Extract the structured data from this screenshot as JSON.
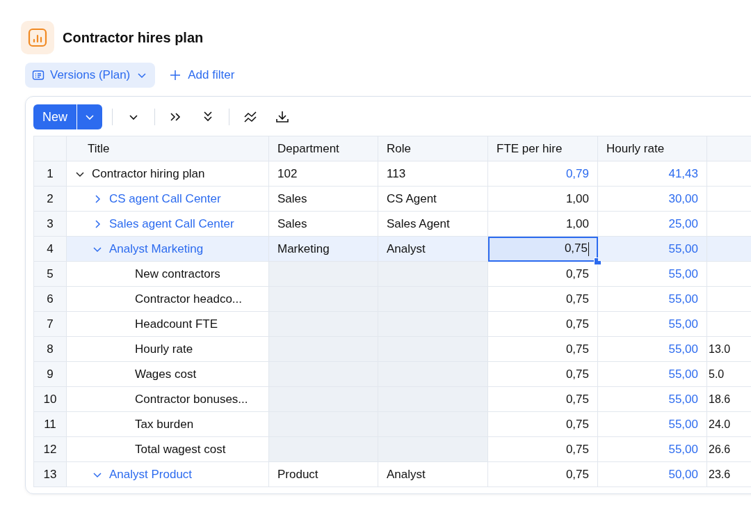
{
  "header": {
    "title": "Contractor hires plan"
  },
  "filters": {
    "version_filter": "Versions (Plan)",
    "add_filter": "Add filter"
  },
  "toolbar": {
    "new_button": "New"
  },
  "table": {
    "columns": [
      "Title",
      "Department",
      "Role",
      "FTE per hire",
      "Hourly rate"
    ],
    "rows": [
      {
        "number": "1",
        "kind": "root",
        "title": "Contractor hiring plan",
        "department": "102",
        "role": "113",
        "fte": "0,79",
        "hourly_rate": "41,43",
        "expanded": true,
        "selected": false,
        "children": [
          {
            "number": "2",
            "kind": "group",
            "title": "CS agent Call Center",
            "department": "Sales",
            "role": "CS Agent",
            "fte": "1,00",
            "hourly_rate": "30,00",
            "expanded": false,
            "selected": false
          },
          {
            "number": "3",
            "kind": "group",
            "title": "Sales agent Call Center",
            "department": "Sales",
            "role": "Sales Agent",
            "fte": "1,00",
            "hourly_rate": "25,00",
            "expanded": false,
            "selected": false
          },
          {
            "number": "4",
            "kind": "group",
            "title": "Analyst Marketing",
            "department": "Marketing",
            "role": "Analyst",
            "fte": "0,75",
            "hourly_rate": "55,00",
            "expanded": true,
            "selected": true,
            "children": [
              {
                "number": "5",
                "kind": "metric",
                "title": "New contractors",
                "fte": "0,75",
                "hourly_rate": "55,00",
                "selected": false
              },
              {
                "number": "6",
                "kind": "metric",
                "title": "Contractor headco...",
                "fte": "0,75",
                "hourly_rate": "55,00",
                "selected": false
              },
              {
                "number": "7",
                "kind": "metric",
                "title": "Headcount FTE",
                "fte": "0,75",
                "hourly_rate": "55,00",
                "selected": false
              },
              {
                "number": "8",
                "kind": "metric",
                "title": "Hourly rate",
                "fte": "0,75",
                "hourly_rate": "55,00",
                "column_6": "13.0",
                "selected": false
              },
              {
                "number": "9",
                "kind": "metric",
                "title": "Wages cost",
                "fte": "0,75",
                "hourly_rate": "55,00",
                "column_6": "5.0",
                "selected": false
              },
              {
                "number": "10",
                "kind": "metric",
                "title": "Contractor bonuses...",
                "fte": "0,75",
                "hourly_rate": "55,00",
                "column_6": "18.6",
                "selected": false
              },
              {
                "number": "11",
                "kind": "metric",
                "title": "Tax burden",
                "fte": "0,75",
                "hourly_rate": "55,00",
                "column_6": "24.0",
                "selected": false
              },
              {
                "number": "12",
                "kind": "metric",
                "title": "Total wagest cost",
                "fte": "0,75",
                "hourly_rate": "55,00",
                "column_6": "26.6",
                "selected": false
              }
            ]
          },
          {
            "number": "13",
            "kind": "group",
            "title": "Analyst Product",
            "department": "Product",
            "role": "Analyst",
            "fte": "0,75",
            "hourly_rate": "50,00",
            "column_6": "23.6",
            "expanded": true,
            "selected": false
          }
        ]
      }
    ]
  }
}
